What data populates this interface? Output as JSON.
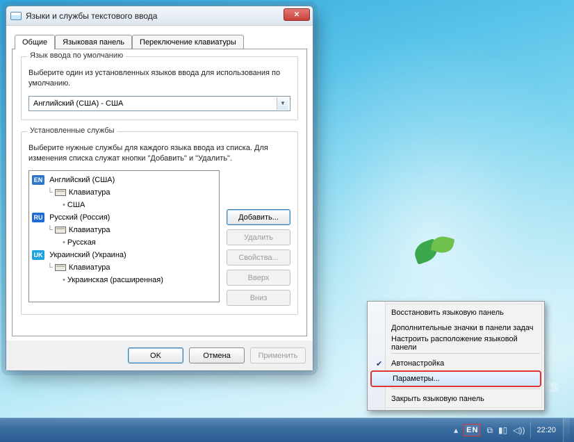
{
  "colors": {
    "badge_en": "#2e77c9",
    "badge_ru": "#1e6bd6",
    "badge_uk": "#1fa3e0",
    "highlight": "#d33"
  },
  "window": {
    "title": "Языки и службы текстового ввода",
    "tabs": [
      "Общие",
      "Языковая панель",
      "Переключение клавиатуры"
    ],
    "active_tab": 0,
    "group_default": {
      "title": "Язык ввода по умолчанию",
      "desc": "Выберите один из установленных языков ввода для использования по умолчанию.",
      "value": "Английский (США) - США"
    },
    "group_services": {
      "title": "Установленные службы",
      "desc": "Выберите нужные службы для каждого языка ввода из списка. Для изменения списка служат кнопки \"Добавить\" и \"Удалить\".",
      "langs": [
        {
          "badge": "EN",
          "badge_color": "#2e77c9",
          "name": "Английский (США)",
          "kbd": "Клавиатура",
          "layout": "США"
        },
        {
          "badge": "RU",
          "badge_color": "#1e6bd6",
          "name": "Русский (Россия)",
          "kbd": "Клавиатура",
          "layout": "Русская"
        },
        {
          "badge": "UK",
          "badge_color": "#1fa3e0",
          "name": "Украинский (Украина)",
          "kbd": "Клавиатура",
          "layout": "Украинская (расширенная)"
        }
      ],
      "buttons": {
        "add": "Добавить...",
        "remove": "Удалить",
        "properties": "Свойства...",
        "up": "Вверх",
        "down": "Вниз"
      }
    },
    "footer": {
      "ok": "OK",
      "cancel": "Отмена",
      "apply": "Применить"
    }
  },
  "context_menu": {
    "items": [
      {
        "label": "Восстановить языковую панель",
        "checked": false
      },
      {
        "label": "Дополнительные значки в панели задач",
        "checked": false
      },
      {
        "label": "Настроить расположение языковой панели",
        "checked": false
      },
      {
        "sep": true
      },
      {
        "label": "Автонастройка",
        "checked": true
      },
      {
        "label": "Параметры...",
        "checked": false,
        "hover": true,
        "highlight": true
      },
      {
        "sep": true
      },
      {
        "label": "Закрыть языковую панель",
        "checked": false
      }
    ]
  },
  "taskbar": {
    "lang": "EN",
    "time": "22:20",
    "tray_arrow": "▴"
  },
  "watermark": "Sovets"
}
